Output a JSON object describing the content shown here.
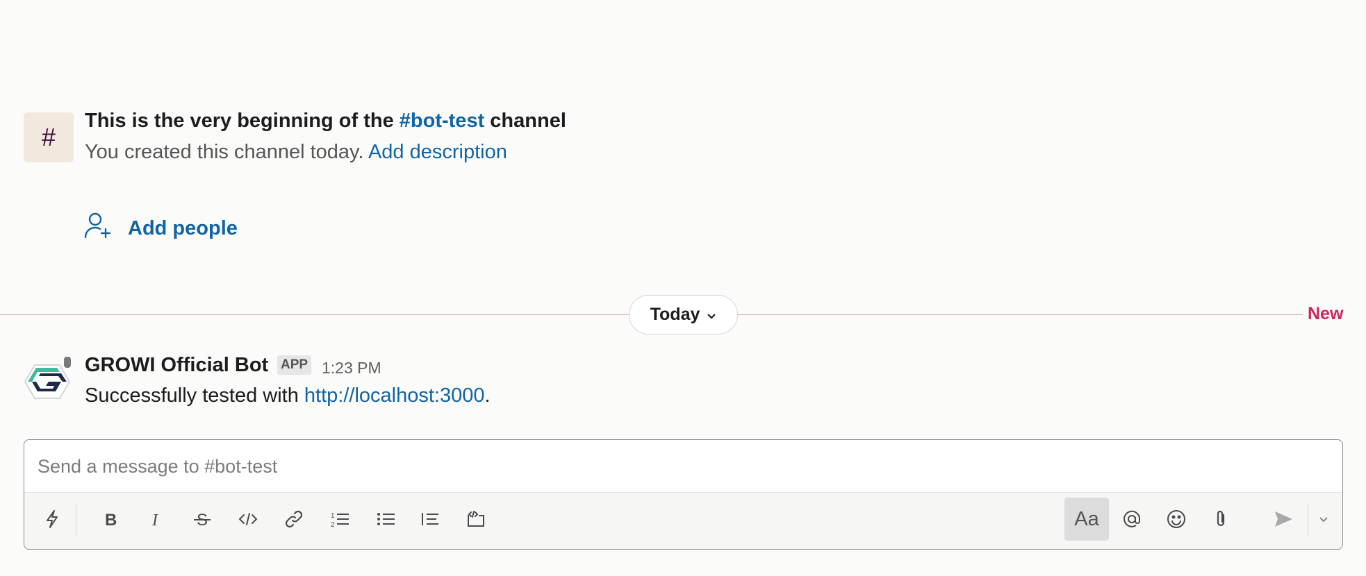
{
  "intro": {
    "channel_icon": "hash-icon",
    "title_prefix": "This is the very beginning of the",
    "channel_name": "#bot-test",
    "title_suffix": "channel",
    "subtitle": "You created this channel today.",
    "add_description": "Add description",
    "add_people": "Add people"
  },
  "divider": {
    "today_label": "Today",
    "new_label": "New"
  },
  "message": {
    "sender": "GROWI Official Bot",
    "badge": "APP",
    "time": "1:23 PM",
    "text_prefix": "Successfully tested with",
    "link": "http://localhost:3000",
    "text_suffix": "."
  },
  "composer": {
    "placeholder": "Send a message to #bot-test",
    "format_label": "Aa"
  },
  "colors": {
    "link": "#1264a3",
    "new": "#d0225f",
    "divider": "#e0a3b3"
  }
}
